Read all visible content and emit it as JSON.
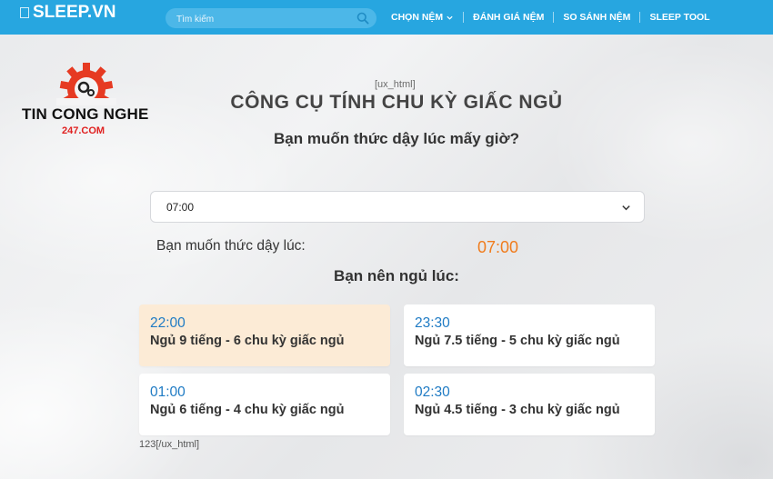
{
  "header": {
    "brand": "SLEEP.VN",
    "search_placeholder": "Tìm kiếm",
    "nav": [
      {
        "label": "CHỌN NỆM",
        "has_dropdown": true
      },
      {
        "label": "ĐÁNH GIÁ NỆM"
      },
      {
        "label": "SO SÁNH NỆM"
      },
      {
        "label": "SLEEP TOOL"
      }
    ],
    "accent_color": "#27a6e0"
  },
  "logo": {
    "name": "TIN CONG NGHE",
    "sub": "247.COM"
  },
  "main": {
    "ux_open": "[ux_html]",
    "title": "CÔNG CỤ TÍNH CHU KỲ GIẤC NGỦ",
    "question": "Bạn muốn thức dậy lúc mấy giờ?",
    "selected_time": "07:00",
    "wake_label": "Bạn muốn thức dậy lúc:",
    "wake_time": "07:00",
    "should_sleep": "Bạn nên ngủ lúc:",
    "results": [
      {
        "time": "22:00",
        "desc": "Ngủ 9 tiếng - 6 chu kỳ giấc ngủ",
        "highlight": true
      },
      {
        "time": "23:30",
        "desc": "Ngủ 7.5 tiếng - 5 chu kỳ giấc ngủ",
        "highlight": false
      },
      {
        "time": "01:00",
        "desc": "Ngủ 6 tiếng - 4 chu kỳ giấc ngủ",
        "highlight": false
      },
      {
        "time": "02:30",
        "desc": "Ngủ 4.5 tiếng - 3 chu kỳ giấc ngủ",
        "highlight": false
      }
    ],
    "footer_text": "123[/ux_html]"
  }
}
